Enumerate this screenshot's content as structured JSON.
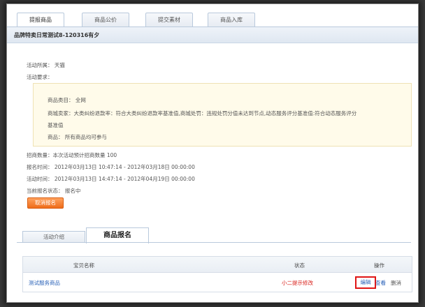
{
  "top_tabs": [
    {
      "label": "提报商品",
      "active": true
    },
    {
      "label": "商品公价",
      "active": false
    },
    {
      "label": "提交素材",
      "active": false
    },
    {
      "label": "商品入库",
      "active": false
    }
  ],
  "activity_title": "品牌特卖日常测试8-120316有夕",
  "details": {
    "belongs": "活动所属： 天猫",
    "requirements_label": "活动要求："
  },
  "rules": {
    "category": "商品类目： 全网",
    "merchant_line1": "商城卖家：大类纠纷退款率：符合大类纠纷退款率基准值,商城处罚：违规处罚分值未达到节点,动态服务评分基准值:符合动态服务评分",
    "merchant_line2": "基准值",
    "goods": "商品： 所有商品均可参与"
  },
  "stats": {
    "recruit": "招商数量：本次活动预计招商数量 100",
    "signup_time": "报名时间： 2012年03月13日 10:47:14 - 2012年03月18日 00:00:00",
    "activity_time": "活动时间： 2012年03月13日 14:47:14 - 2012年04月19日 00:00:00",
    "status": "当前报名状态： 报名中"
  },
  "cancel_button": "取消报名",
  "bottom_tabs": [
    {
      "label": "活动介绍",
      "active": false
    },
    {
      "label": "商品报名",
      "active": true
    }
  ],
  "table": {
    "headers": {
      "name": "宝贝名称",
      "status": "状态",
      "ops": "操作"
    },
    "rows": [
      {
        "name": "测试服务商品",
        "status": "小二提示修改",
        "edit": "编辑",
        "view": "查看",
        "delete": "删消"
      }
    ]
  },
  "colors": {
    "accent_orange": "#ee6c1a",
    "link": "#2a62b8",
    "highlight_red": "#e01515"
  }
}
